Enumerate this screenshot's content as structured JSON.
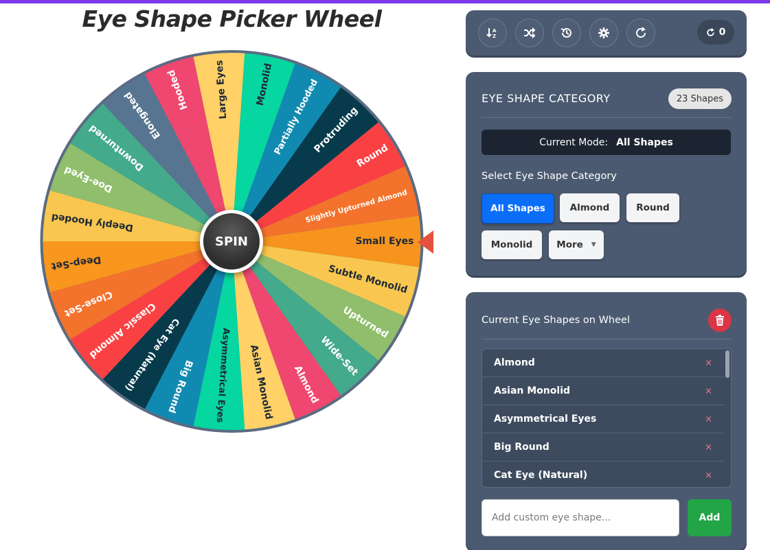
{
  "title": "Eye Shape Picker Wheel",
  "wheel": {
    "spin_label": "SPIN",
    "segments": [
      {
        "label": "Small Eyes",
        "color": "#f7941d",
        "text": "#1f2937"
      },
      {
        "label": "Subtle Monolid",
        "color": "#f9c74f",
        "text": "#1f2937"
      },
      {
        "label": "Upturned",
        "color": "#90be6d",
        "text": "#ffffff"
      },
      {
        "label": "Wide-Set",
        "color": "#43aa8b",
        "text": "#ffffff"
      },
      {
        "label": "Almond",
        "color": "#ef476f",
        "text": "#ffffff"
      },
      {
        "label": "Asian Monolid",
        "color": "#ffd166",
        "text": "#1f2937"
      },
      {
        "label": "Asymmetrical Eyes",
        "color": "#06d6a0",
        "text": "#1f2937"
      },
      {
        "label": "Big Round",
        "color": "#118ab2",
        "text": "#ffffff"
      },
      {
        "label": "Cat Eye (Natural)",
        "color": "#073b4c",
        "text": "#ffffff"
      },
      {
        "label": "Classic Almond",
        "color": "#f94144",
        "text": "#ffffff"
      },
      {
        "label": "Close-Set",
        "color": "#f3722c",
        "text": "#ffffff"
      },
      {
        "label": "Deep-Set",
        "color": "#f8961e",
        "text": "#1f2937"
      },
      {
        "label": "Deeply Hooded",
        "color": "#f9c74f",
        "text": "#1f2937"
      },
      {
        "label": "Doe-Eyed",
        "color": "#90be6d",
        "text": "#ffffff"
      },
      {
        "label": "Downturned",
        "color": "#43aa8b",
        "text": "#ffffff"
      },
      {
        "label": "Elongated",
        "color": "#577590",
        "text": "#ffffff"
      },
      {
        "label": "Hooded",
        "color": "#ef476f",
        "text": "#ffffff"
      },
      {
        "label": "Large Eyes",
        "color": "#ffd166",
        "text": "#1f2937"
      },
      {
        "label": "Monolid",
        "color": "#06d6a0",
        "text": "#1f2937"
      },
      {
        "label": "Partially Hooded",
        "color": "#118ab2",
        "text": "#ffffff"
      },
      {
        "label": "Protruding",
        "color": "#073b4c",
        "text": "#ffffff"
      },
      {
        "label": "Round",
        "color": "#f94144",
        "text": "#ffffff"
      },
      {
        "label": "Slightly Upturned Almond",
        "color": "#f3722c",
        "text": "#ffffff"
      }
    ],
    "pointer_color": "#e4513f",
    "rim_color": "#5a6b82"
  },
  "toolbar": {
    "icons": [
      "sort-icon",
      "shuffle-icon",
      "history-icon",
      "gear-icon",
      "refresh-icon"
    ],
    "spin_count": "0"
  },
  "category": {
    "title": "EYE SHAPE CATEGORY",
    "count_badge": "23 Shapes",
    "mode_label": "Current Mode:",
    "mode_value": "All Shapes",
    "select_label": "Select Eye Shape Category",
    "buttons": {
      "all": "All Shapes",
      "almond": "Almond",
      "round": "Round",
      "monolid": "Monolid",
      "more": "More"
    }
  },
  "list": {
    "title": "Current Eye Shapes on Wheel",
    "items": [
      "Almond",
      "Asian Monolid",
      "Asymmetrical Eyes",
      "Big Round",
      "Cat Eye (Natural)"
    ],
    "remove_symbol": "×",
    "input_placeholder": "Add custom eye shape...",
    "add_label": "Add"
  }
}
